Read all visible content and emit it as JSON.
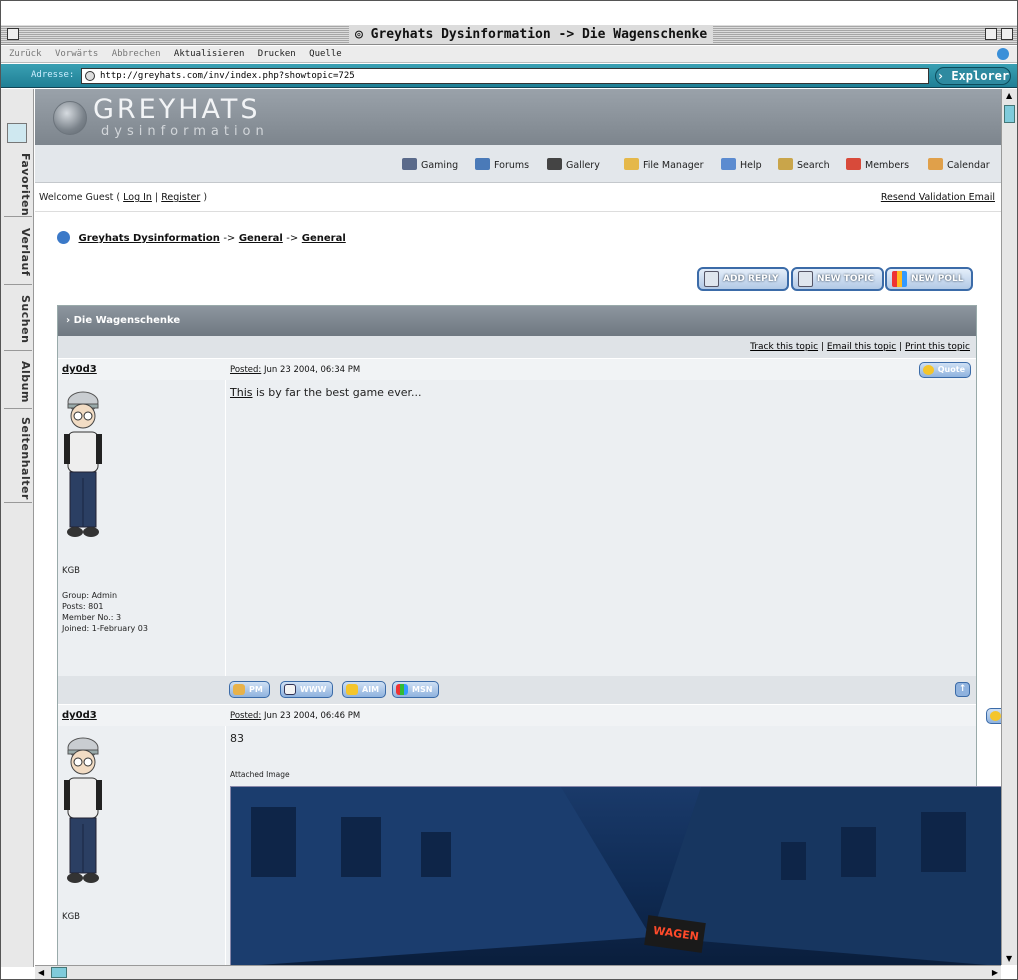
{
  "window": {
    "title": "Greyhats Dysinformation -> Die Wagenschenke"
  },
  "toolbar": {
    "items": [
      "Zurück",
      "Vorwärts",
      "Abbrechen",
      "Aktualisieren",
      "Drucken",
      "Quelle"
    ]
  },
  "address": {
    "label": "Adresse:",
    "url": "http://greyhats.com/inv/index.php?showtopic=725",
    "explorer_label": "Explorer"
  },
  "side_tabs": [
    "Favoriten",
    "Verlauf",
    "Suchen",
    "Album",
    "Seitenhalter"
  ],
  "site": {
    "logo_title": "GREYHATS",
    "logo_sub": "dysinformation"
  },
  "nav": [
    {
      "label": "Gaming",
      "icon": "controller-icon",
      "color": "#5a6a8a"
    },
    {
      "label": "Forums",
      "icon": "forum-icon",
      "color": "#4a7ab8"
    },
    {
      "label": "Gallery",
      "icon": "camera-icon",
      "color": "#444444"
    },
    {
      "label": "File Manager",
      "icon": "folder-icon",
      "color": "#e5b84a"
    },
    {
      "label": "Help",
      "icon": "help-icon",
      "color": "#5b8bd0"
    },
    {
      "label": "Search",
      "icon": "search-icon",
      "color": "#c9a54a"
    },
    {
      "label": "Members",
      "icon": "members-icon",
      "color": "#d84a3a"
    },
    {
      "label": "Calendar",
      "icon": "calendar-icon",
      "color": "#e0a04a"
    }
  ],
  "welcome": {
    "prefix": "Welcome Guest (",
    "login": "Log In",
    "divider": "|",
    "register": "Register",
    "suffix": ")",
    "resend": "Resend Validation Email"
  },
  "breadcrumb": {
    "root": "Greyhats Dysinformation",
    "sep1": "->",
    "level1": "General",
    "sep2": "->",
    "level2": "General"
  },
  "actions": {
    "add_reply": "ADD REPLY",
    "new_topic": "NEW TOPIC",
    "new_poll": "NEW POLL"
  },
  "topic": {
    "title": "Die Wagenschenke",
    "track": "Track this topic",
    "email": "Email this topic",
    "print": "Print this topic",
    "divider": "|"
  },
  "posts": [
    {
      "author": "dy0d3",
      "posted_label": "Posted:",
      "date": "Jun 23 2004, 06:34 PM",
      "quote": "Quote",
      "text_underlined": "This",
      "text_rest": "is by far the best game ever...",
      "member_title": "KGB",
      "group": "Group: Admin",
      "posts": "Posts: 801",
      "member_no": "Member No.: 3",
      "joined": "Joined: 1-February 03",
      "buttons": [
        "PM",
        "WWW",
        "AIM",
        "MSN"
      ]
    },
    {
      "author": "dy0d3",
      "posted_label": "Posted:",
      "date": "Jun 23 2004, 06:46 PM",
      "text": "83",
      "attached_label": "Attached Image",
      "member_title": "KGB",
      "image_sign": "WAGEN"
    }
  ],
  "colors": {
    "accent": "#3b6ba8",
    "banner": "#8a929a",
    "address_bar": "#2f94a9"
  }
}
